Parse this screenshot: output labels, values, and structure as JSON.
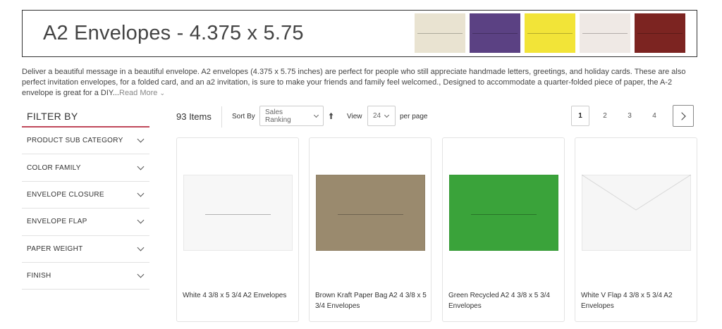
{
  "banner": {
    "title": "A2 Envelopes - 4.375 x 5.75",
    "swatches": [
      {
        "name": "cream",
        "color": "#e9e3d1"
      },
      {
        "name": "purple",
        "color": "#5b4183"
      },
      {
        "name": "yellow",
        "color": "#f2e438"
      },
      {
        "name": "blush",
        "color": "#efe9e5"
      },
      {
        "name": "burgundy",
        "color": "#7c2421"
      }
    ]
  },
  "description": {
    "text": "Deliver a beautiful message in a beautiful envelope. A2 envelopes (4.375 x 5.75 inches) are perfect for people who still appreciate handmade letters, greetings, and holiday cards. These are also perfect invitation envelopes, for a folded card, and an a2 invitation, is sure to make your friends and family feel welcomed., Designed to accommodate a quarter-folded piece of paper, the A-2 envelope is great for a DIY...",
    "read_more": "Read More"
  },
  "filter": {
    "title": "FILTER BY",
    "items": [
      {
        "label": "PRODUCT SUB CATEGORY"
      },
      {
        "label": "COLOR FAMILY"
      },
      {
        "label": "ENVELOPE CLOSURE"
      },
      {
        "label": "ENVELOPE FLAP"
      },
      {
        "label": "PAPER WEIGHT"
      },
      {
        "label": "FINISH"
      }
    ]
  },
  "toolbar": {
    "item_count": "93 Items",
    "sort_label": "Sort By",
    "sort_value": "Sales Ranking",
    "view_label": "View",
    "view_value": "24",
    "per_page": "per page",
    "pages": [
      "1",
      "2",
      "3",
      "4"
    ],
    "active_page": "1"
  },
  "products": [
    {
      "name": "White 4 3/8 x 5 3/4 A2 Envelopes",
      "color": "#f7f7f7",
      "flap": "square"
    },
    {
      "name": "Brown Kraft Paper Bag A2 4 3/8 x 5 3/4 Envelopes",
      "color": "#9a8a6e",
      "flap": "square"
    },
    {
      "name": "Green Recycled A2 4 3/8 x 5 3/4 Envelopes",
      "color": "#3aa33a",
      "flap": "square"
    },
    {
      "name": "White V Flap 4 3/8 x 5 3/4 A2 Envelopes",
      "color": "#f6f6f6",
      "flap": "v-flap"
    }
  ],
  "colors": {
    "accent": "#c0485a",
    "border": "#e3e3e3"
  }
}
